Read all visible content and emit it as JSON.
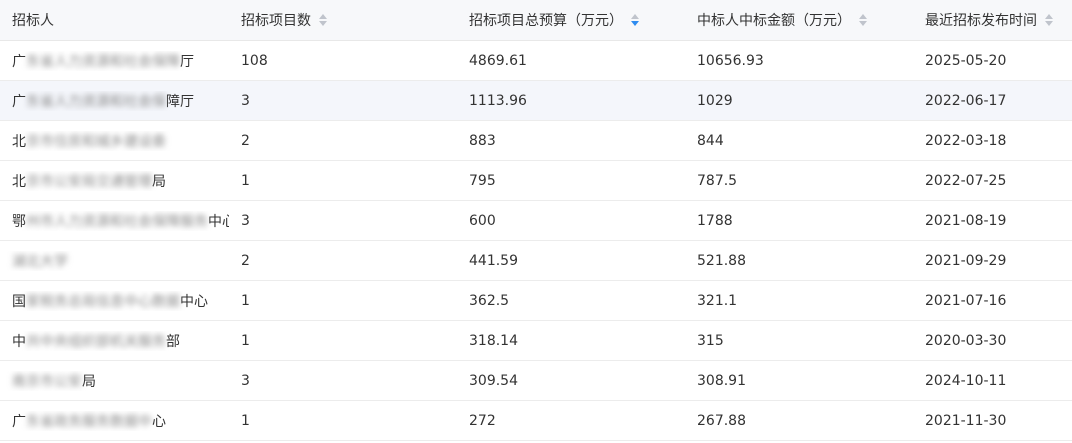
{
  "colors": {
    "accent": "#2f8cf0",
    "header_bg": "#f7f8fa",
    "highlight_row": "#f4f6fb",
    "border": "#e8e8e8"
  },
  "table": {
    "headers": {
      "tenderer": "招标人",
      "project_count": "招标项目数",
      "total_budget": "招标项目总预算（万元）",
      "winning_amount": "中标人中标金额（万元）",
      "latest_date": "最近招标发布时间"
    },
    "sort": {
      "column": "total_budget",
      "direction": "desc",
      "icon": "sort-caret-icon"
    },
    "rows": [
      {
        "name_pre": "广",
        "name_blur": "东省人力资源和社会保障",
        "name_post": "厅",
        "count": "108",
        "budget": "4869.61",
        "amount": "10656.93",
        "date": "2025-05-20"
      },
      {
        "name_pre": "广",
        "name_blur": "东省人力资源和社会保",
        "name_post": "障厅",
        "count": "3",
        "budget": "1113.96",
        "amount": "1029",
        "date": "2022-06-17"
      },
      {
        "name_pre": "北",
        "name_blur": "京市住房和城乡建设委",
        "name_post": "",
        "count": "2",
        "budget": "883",
        "amount": "844",
        "date": "2022-03-18"
      },
      {
        "name_pre": "北",
        "name_blur": "京市公安局交通管理",
        "name_post": "局",
        "count": "1",
        "budget": "795",
        "amount": "787.5",
        "date": "2022-07-25"
      },
      {
        "name_pre": "鄂",
        "name_blur": "州市人力资源和社会保障服务",
        "name_post": "中心",
        "count": "3",
        "budget": "600",
        "amount": "1788",
        "date": "2021-08-19"
      },
      {
        "name_pre": "",
        "name_blur": "湖北大学",
        "name_post": "",
        "count": "2",
        "budget": "441.59",
        "amount": "521.88",
        "date": "2021-09-29"
      },
      {
        "name_pre": "国",
        "name_blur": "家税务总局信息中心数据",
        "name_post": "中心",
        "count": "1",
        "budget": "362.5",
        "amount": "321.1",
        "date": "2021-07-16"
      },
      {
        "name_pre": "中",
        "name_blur": "共中央组织部机关服务",
        "name_post": "部",
        "count": "1",
        "budget": "318.14",
        "amount": "315",
        "date": "2020-03-30"
      },
      {
        "name_pre": "",
        "name_blur": "南京市公安",
        "name_post": "局",
        "count": "3",
        "budget": "309.54",
        "amount": "308.91",
        "date": "2024-10-11"
      },
      {
        "name_pre": "广",
        "name_blur": "东省政务服务数据中",
        "name_post": "心",
        "count": "1",
        "budget": "272",
        "amount": "267.88",
        "date": "2021-11-30"
      }
    ]
  }
}
